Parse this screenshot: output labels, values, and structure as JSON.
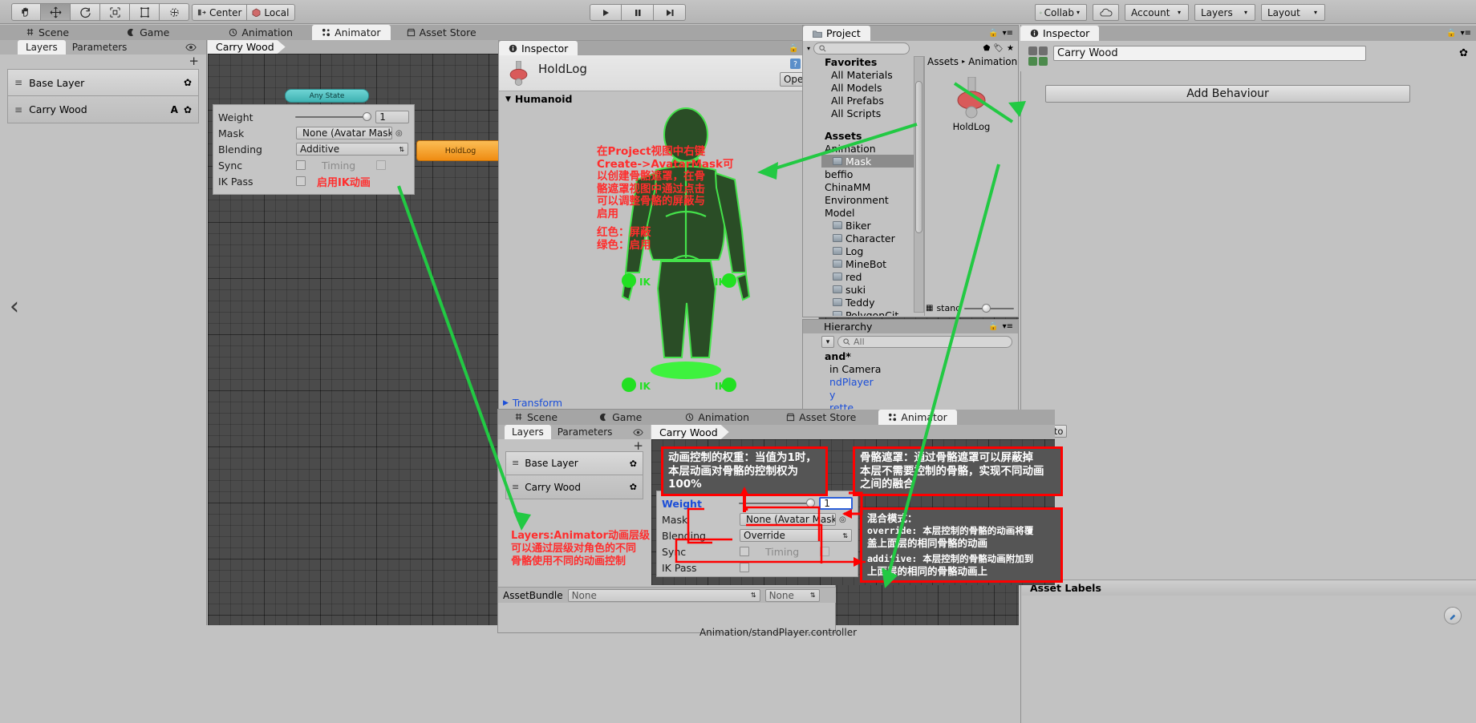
{
  "toolbar": {
    "tools": [
      "hand-tool",
      "move-tool",
      "rotate-tool",
      "scale-tool",
      "rect-tool",
      "transform-tool"
    ],
    "pivot_label": "Center",
    "space_label": "Local",
    "play_label": "play-icon",
    "pause_label": "pause-icon",
    "step_label": "step-icon",
    "collab_label": "Collab",
    "cloud_label": "cloud-icon",
    "account_label": "Account",
    "layers_label": "Layers",
    "layout_label": "Layout"
  },
  "main_tabs": [
    {
      "label": "Scene",
      "icon": "grid-icon",
      "active": false
    },
    {
      "label": "Game",
      "icon": "gamepad-icon",
      "active": false
    },
    {
      "label": "Animation",
      "icon": "clock-icon",
      "active": false
    },
    {
      "label": "Animator",
      "icon": "animator-icon",
      "active": true
    },
    {
      "label": "Asset Store",
      "icon": "store-icon",
      "active": false
    }
  ],
  "animator_top": {
    "subtabs": [
      "Layers",
      "Parameters"
    ],
    "active_subtab": "Layers",
    "eye_icon": "eye-icon",
    "add_label": "+",
    "layers": [
      {
        "name": "Base Layer",
        "badge": "",
        "gear": "gear-icon"
      },
      {
        "name": "Carry Wood",
        "badge": "A",
        "gear": "gear-icon"
      }
    ],
    "breadcrumb": "Carry Wood",
    "any_state": "Any State",
    "state_node": "HoldLog",
    "settings": {
      "weight_label": "Weight",
      "weight_value": "1",
      "mask_label": "Mask",
      "mask_value": "None (Avatar Mask",
      "blending_label": "Blending",
      "blending_value": "Additive",
      "sync_label": "Sync",
      "timing_label": "Timing",
      "ikpass_label": "IK Pass",
      "ikpass_note": "启用IK动画"
    }
  },
  "inspector_mid": {
    "title": "Inspector",
    "object_name": "HoldLog",
    "open_label": "Open",
    "section_label": "Humanoid",
    "transform_label": "Transform",
    "ik_labels": [
      "IK",
      "IK",
      "IK",
      "IK"
    ],
    "help_icon": "help-icon",
    "gear_icon": "gear-icon",
    "annotation": {
      "lines": [
        "在Project视图中右键",
        "Create->AvatarMask可",
        "以创建骨骼遮罩，在骨",
        "骼遮罩视图中通过点击",
        "可以调整骨骼的屏蔽与",
        "启用"
      ],
      "legend": [
        "红色：屏蔽",
        "绿色：启用"
      ]
    }
  },
  "project": {
    "title": "Project",
    "search_placeholder": "",
    "favorites_header": "Favorites",
    "favorites": [
      "All Materials",
      "All Models",
      "All Prefabs",
      "All Scripts"
    ],
    "assets_header": "Assets",
    "assets": [
      {
        "name": "Animation",
        "folder": false,
        "selected": false,
        "indent": 0
      },
      {
        "name": "Mask",
        "folder": true,
        "selected": true,
        "indent": 1
      },
      {
        "name": "beffio",
        "folder": false,
        "selected": false,
        "indent": 0
      },
      {
        "name": "ChinaMM",
        "folder": false,
        "selected": false,
        "indent": 0
      },
      {
        "name": "Environment",
        "folder": false,
        "selected": false,
        "indent": 0
      },
      {
        "name": "Model",
        "folder": false,
        "selected": false,
        "indent": 0
      },
      {
        "name": "Biker",
        "folder": true,
        "selected": false,
        "indent": 1
      },
      {
        "name": "Character",
        "folder": true,
        "selected": false,
        "indent": 1
      },
      {
        "name": "Log",
        "folder": true,
        "selected": false,
        "indent": 1
      },
      {
        "name": "MineBot",
        "folder": true,
        "selected": false,
        "indent": 1
      },
      {
        "name": "red",
        "folder": true,
        "selected": false,
        "indent": 1
      },
      {
        "name": "suki",
        "folder": true,
        "selected": false,
        "indent": 1
      },
      {
        "name": "Teddy",
        "folder": true,
        "selected": false,
        "indent": 1
      },
      {
        "name": "PolygonCit",
        "folder": true,
        "selected": false,
        "indent": 1
      }
    ],
    "breadcrumb": [
      "Assets",
      "Animation"
    ],
    "asset_item": "HoldLog",
    "zoom_label": "stand"
  },
  "hierarchy": {
    "title": "Hierarchy",
    "search_value": "All",
    "create_label": "+",
    "items": [
      "and*",
      "in Camera",
      "ndPlayer",
      "y",
      "rette"
    ]
  },
  "inspector_right": {
    "title": "Inspector",
    "name_value": "Carry Wood",
    "add_behaviour_label": "Add Behaviour",
    "gear_icon": "gear-icon",
    "asset_labels_title": "Asset Labels"
  },
  "animator_bottom": {
    "tabs": [
      {
        "label": "Scene",
        "icon": "grid-icon",
        "active": false
      },
      {
        "label": "Game",
        "icon": "gamepad-icon",
        "active": false
      },
      {
        "label": "Animation",
        "icon": "clock-icon",
        "active": false
      },
      {
        "label": "Asset Store",
        "icon": "store-icon",
        "active": false
      },
      {
        "label": "Animator",
        "icon": "animator-icon",
        "active": true
      }
    ],
    "auto_label": "Auto",
    "subtabs": [
      "Layers",
      "Parameters"
    ],
    "active_subtab": "Layers",
    "add_label": "+",
    "layers": [
      {
        "name": "Base Layer",
        "gear": "gear-icon"
      },
      {
        "name": "Carry Wood",
        "gear": "gear-icon"
      }
    ],
    "breadcrumb": "Carry Wood",
    "settings": {
      "weight_label": "Weight",
      "weight_value": "1",
      "mask_label": "Mask",
      "mask_value": "None (Avatar Mask",
      "blending_label": "Blending",
      "blending_value": "Override",
      "sync_label": "Sync",
      "timing_label": "Timing",
      "ikpass_label": "IK Pass"
    },
    "assetbundle_label": "AssetBundle",
    "assetbundle_value": "None",
    "assetbundle_value2": "None",
    "statusbar": "Animation/standPlayer.controller"
  },
  "annotations": {
    "weight_box": [
      "动画控制的权重：当值为1时，",
      "本层动画对骨骼的控制权为100%"
    ],
    "mask_box": [
      "骨骼遮罩：通过骨骼遮罩可以屏蔽掉",
      "本层不需要控制的骨骼，实现不同动画",
      "之间的融合"
    ],
    "blend_box": [
      "混合模式：",
      "override: 本层控制的骨骼的动画将覆",
      "盖上面层的相同骨骼的动画",
      "additive: 本层控制的骨骼动画附加到",
      "上面层的相同的骨骼动画上"
    ],
    "layers_box": [
      "Layers:Animator动画层级",
      "可以通过层级对角色的不同",
      "骨骼使用不同的动画控制"
    ]
  },
  "colors": {
    "red": "#ff0000",
    "green": "#22c943",
    "orange": "#f0921e",
    "teal": "#4ec0c0",
    "blue": "#1b4ed8"
  }
}
